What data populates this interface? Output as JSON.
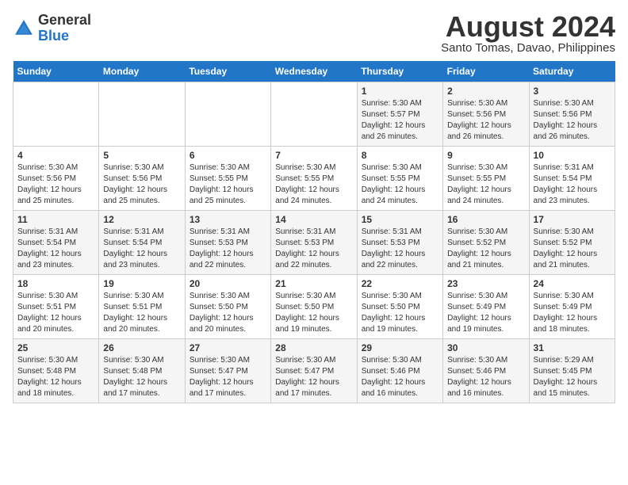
{
  "header": {
    "logo_general": "General",
    "logo_blue": "Blue",
    "month_title": "August 2024",
    "subtitle": "Santo Tomas, Davao, Philippines"
  },
  "weekdays": [
    "Sunday",
    "Monday",
    "Tuesday",
    "Wednesday",
    "Thursday",
    "Friday",
    "Saturday"
  ],
  "weeks": [
    [
      {
        "day": "",
        "info": ""
      },
      {
        "day": "",
        "info": ""
      },
      {
        "day": "",
        "info": ""
      },
      {
        "day": "",
        "info": ""
      },
      {
        "day": "1",
        "info": "Sunrise: 5:30 AM\nSunset: 5:57 PM\nDaylight: 12 hours\nand 26 minutes."
      },
      {
        "day": "2",
        "info": "Sunrise: 5:30 AM\nSunset: 5:56 PM\nDaylight: 12 hours\nand 26 minutes."
      },
      {
        "day": "3",
        "info": "Sunrise: 5:30 AM\nSunset: 5:56 PM\nDaylight: 12 hours\nand 26 minutes."
      }
    ],
    [
      {
        "day": "4",
        "info": "Sunrise: 5:30 AM\nSunset: 5:56 PM\nDaylight: 12 hours\nand 25 minutes."
      },
      {
        "day": "5",
        "info": "Sunrise: 5:30 AM\nSunset: 5:56 PM\nDaylight: 12 hours\nand 25 minutes."
      },
      {
        "day": "6",
        "info": "Sunrise: 5:30 AM\nSunset: 5:55 PM\nDaylight: 12 hours\nand 25 minutes."
      },
      {
        "day": "7",
        "info": "Sunrise: 5:30 AM\nSunset: 5:55 PM\nDaylight: 12 hours\nand 24 minutes."
      },
      {
        "day": "8",
        "info": "Sunrise: 5:30 AM\nSunset: 5:55 PM\nDaylight: 12 hours\nand 24 minutes."
      },
      {
        "day": "9",
        "info": "Sunrise: 5:30 AM\nSunset: 5:55 PM\nDaylight: 12 hours\nand 24 minutes."
      },
      {
        "day": "10",
        "info": "Sunrise: 5:31 AM\nSunset: 5:54 PM\nDaylight: 12 hours\nand 23 minutes."
      }
    ],
    [
      {
        "day": "11",
        "info": "Sunrise: 5:31 AM\nSunset: 5:54 PM\nDaylight: 12 hours\nand 23 minutes."
      },
      {
        "day": "12",
        "info": "Sunrise: 5:31 AM\nSunset: 5:54 PM\nDaylight: 12 hours\nand 23 minutes."
      },
      {
        "day": "13",
        "info": "Sunrise: 5:31 AM\nSunset: 5:53 PM\nDaylight: 12 hours\nand 22 minutes."
      },
      {
        "day": "14",
        "info": "Sunrise: 5:31 AM\nSunset: 5:53 PM\nDaylight: 12 hours\nand 22 minutes."
      },
      {
        "day": "15",
        "info": "Sunrise: 5:31 AM\nSunset: 5:53 PM\nDaylight: 12 hours\nand 22 minutes."
      },
      {
        "day": "16",
        "info": "Sunrise: 5:30 AM\nSunset: 5:52 PM\nDaylight: 12 hours\nand 21 minutes."
      },
      {
        "day": "17",
        "info": "Sunrise: 5:30 AM\nSunset: 5:52 PM\nDaylight: 12 hours\nand 21 minutes."
      }
    ],
    [
      {
        "day": "18",
        "info": "Sunrise: 5:30 AM\nSunset: 5:51 PM\nDaylight: 12 hours\nand 20 minutes."
      },
      {
        "day": "19",
        "info": "Sunrise: 5:30 AM\nSunset: 5:51 PM\nDaylight: 12 hours\nand 20 minutes."
      },
      {
        "day": "20",
        "info": "Sunrise: 5:30 AM\nSunset: 5:50 PM\nDaylight: 12 hours\nand 20 minutes."
      },
      {
        "day": "21",
        "info": "Sunrise: 5:30 AM\nSunset: 5:50 PM\nDaylight: 12 hours\nand 19 minutes."
      },
      {
        "day": "22",
        "info": "Sunrise: 5:30 AM\nSunset: 5:50 PM\nDaylight: 12 hours\nand 19 minutes."
      },
      {
        "day": "23",
        "info": "Sunrise: 5:30 AM\nSunset: 5:49 PM\nDaylight: 12 hours\nand 19 minutes."
      },
      {
        "day": "24",
        "info": "Sunrise: 5:30 AM\nSunset: 5:49 PM\nDaylight: 12 hours\nand 18 minutes."
      }
    ],
    [
      {
        "day": "25",
        "info": "Sunrise: 5:30 AM\nSunset: 5:48 PM\nDaylight: 12 hours\nand 18 minutes."
      },
      {
        "day": "26",
        "info": "Sunrise: 5:30 AM\nSunset: 5:48 PM\nDaylight: 12 hours\nand 17 minutes."
      },
      {
        "day": "27",
        "info": "Sunrise: 5:30 AM\nSunset: 5:47 PM\nDaylight: 12 hours\nand 17 minutes."
      },
      {
        "day": "28",
        "info": "Sunrise: 5:30 AM\nSunset: 5:47 PM\nDaylight: 12 hours\nand 17 minutes."
      },
      {
        "day": "29",
        "info": "Sunrise: 5:30 AM\nSunset: 5:46 PM\nDaylight: 12 hours\nand 16 minutes."
      },
      {
        "day": "30",
        "info": "Sunrise: 5:30 AM\nSunset: 5:46 PM\nDaylight: 12 hours\nand 16 minutes."
      },
      {
        "day": "31",
        "info": "Sunrise: 5:29 AM\nSunset: 5:45 PM\nDaylight: 12 hours\nand 15 minutes."
      }
    ]
  ]
}
